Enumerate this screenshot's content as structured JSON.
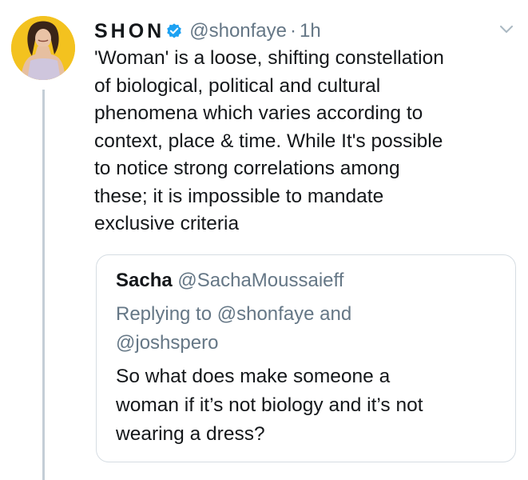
{
  "tweet": {
    "author": {
      "display_name": "SHON",
      "handle": "@shonfaye",
      "time": "1h",
      "separator": "·",
      "verified_icon": "verified-badge-icon",
      "avatar_color": "#f3c21f"
    },
    "text_lines": [
      "'Woman' is a loose, shifting constellation",
      "of biological, political and cultural",
      "phenomena which varies according to",
      "context, place & time. While It's possible",
      "to notice strong correlations among",
      "these; it is impossible to mandate",
      "exclusive criteria"
    ],
    "menu_icon": "chevron-down-icon"
  },
  "quoted_tweet": {
    "name": "Sacha",
    "handle": "@SachaMoussaieff",
    "reply_lines": [
      "Replying to @shonfaye and",
      "@joshspero"
    ],
    "text_lines": [
      "So what does make someone a",
      "woman if it’s not biology and it’s not",
      "wearing a dress?"
    ]
  },
  "colors": {
    "text": "#14171a",
    "secondary": "#657786",
    "verified": "#1da1f2",
    "border": "#d6dde3",
    "thread_line": "#c4ced6"
  }
}
